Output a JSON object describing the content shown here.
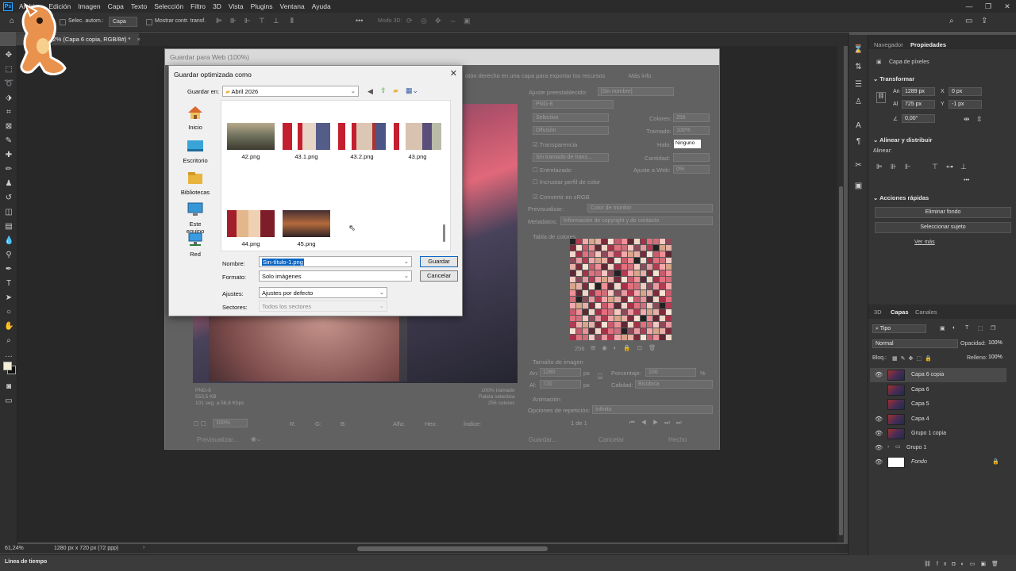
{
  "menu": {
    "app_icon": "Ps",
    "items": [
      "Archivo",
      "Edición",
      "Imagen",
      "Capa",
      "Texto",
      "Selección",
      "Filtro",
      "3D",
      "Vista",
      "Plugins",
      "Ventana",
      "Ayuda"
    ]
  },
  "options_bar": {
    "auto_select_label": "Selec. autom.:",
    "auto_select_value": "Capa",
    "show_transform_label": "Mostrar contr. transf.",
    "mode_3d": "Modo 3D:"
  },
  "document_tab": {
    "title": "61,2% (Capa 6 copia, RGB/8#) *",
    "close": "×"
  },
  "status_bar": {
    "zoom": "61,24%",
    "doc_size": "1280 px x 720 px (72 ppp)"
  },
  "timeline": {
    "label": "Línea de tiempo"
  },
  "save_for_web": {
    "title": "Guardar para Web (100%)",
    "hint": "otón derecho en una capa para exportar los recursos",
    "more_info": "Más info.",
    "preset_label": "Ajuste preestablecido:",
    "preset_value": "[Sin nombre]",
    "format": "PNG-8",
    "reduction": "Selectivo",
    "dither": "Difusión",
    "colors_label": "Colores:",
    "colors_value": "256",
    "dither_amount_label": "Tramado:",
    "dither_amount_value": "100%",
    "transparency": "Transparencia",
    "matte_label": "Halo:",
    "matte_value": "Ninguno",
    "transparency_dither": "Sin tramado de trans...",
    "amount_label": "Cantidad:",
    "interlaced": "Entrelazado",
    "web_snap_label": "Ajuste a Web:",
    "web_snap_value": "0%",
    "embed_profile": "Incrustar perfil de color",
    "convert_srgb": "Convertir en sRGB",
    "preview_label": "Previsualizar:",
    "preview_value": "Color de monitor",
    "metadata_label": "Metadatos:",
    "metadata_value": "Información de copyright y de contacto",
    "color_table": "Tabla de colores",
    "color_count": "256",
    "image_size": "Tamaño de imagen",
    "width_label": "An:",
    "width_value": "1280",
    "height_label": "Al:",
    "height_value": "720",
    "px": "px",
    "percent_label": "Porcentaje:",
    "percent_value": "100",
    "pct": "%",
    "quality_label": "Calidad:",
    "quality_value": "Bicúbica",
    "animation": "Animación",
    "loop_label": "Opciones de repetición:",
    "loop_value": "Infinito",
    "frame": "1 de 1",
    "info_left": [
      "PNG-8",
      "553,5 KB",
      "101 seg. a 56,6 Kbps"
    ],
    "info_right": [
      "100% tramado",
      "Paleta selectiva",
      "256 colores"
    ],
    "zoom": "100%",
    "readout": {
      "r": "R:",
      "g": "G:",
      "b": "B:",
      "alpha": "Alfa:",
      "hex": "Hex:",
      "index": "Índice:"
    },
    "preview_btn": "Previsualizar...",
    "save_btn": "Guardar...",
    "cancel_btn": "Cancelar",
    "done_btn": "Hecho",
    "palette": [
      "#e89aa0",
      "#c95b6d",
      "#f3c9c1",
      "#7b2b3c",
      "#e4707d",
      "#d8a58a",
      "#f0d8c8",
      "#b23b53",
      "#ef8f96",
      "#8c4b5a",
      "#f7e3d4",
      "#cf6f7b",
      "#e7b0a6",
      "#a5324a",
      "#f4a8ab",
      "#5c2a36"
    ]
  },
  "save_dialog": {
    "title": "Guardar optimizada como",
    "close": "✕",
    "save_in_label": "Guardar en:",
    "folder": "Abril 2026",
    "places": [
      "Inicio",
      "Escritorio",
      "Bibliotecas",
      "Este equipo",
      "Red"
    ],
    "files": [
      "42.png",
      "43.1.png",
      "43.2.png",
      "43.png",
      "44.png",
      "45.png"
    ],
    "name_label": "Nombre:",
    "name_value": "Sin-título-1.png",
    "format_label": "Formato:",
    "format_value": "Solo imágenes",
    "settings_label": "Ajustes:",
    "settings_value": "Ajustes por defecto",
    "slices_label": "Sectores:",
    "slices_value": "Todos los sectores",
    "save_btn": "Guardar",
    "cancel_btn": "Cancelar"
  },
  "right_panel": {
    "tabs": [
      "Navegador",
      "Propiedades"
    ],
    "layer_type": "Capa de píxeles",
    "transform_title": "Transformar",
    "w_label": "An",
    "w_value": "1289 px",
    "h_label": "Al",
    "h_value": "725 px",
    "x_label": "X",
    "x_value": "0 px",
    "y_label": "Y",
    "y_value": "-1 px",
    "angle_value": "0,00°",
    "align_title": "Alinear y distribuir",
    "align_label": "Alinear:",
    "quick_title": "Acciones rápidas",
    "remove_bg": "Eliminar fondo",
    "select_subject": "Seleccionar sujeto",
    "see_more": "Ver más",
    "more_dots": "•••"
  },
  "layers_panel": {
    "tabs": [
      "3D",
      "Capas",
      "Canales"
    ],
    "filter": "Tipo",
    "blend": "Normal",
    "opacity_label": "Opacidad:",
    "opacity_value": "100%",
    "lock_label": "Bloq.:",
    "fill_label": "Relleno:",
    "fill_value": "100%",
    "layers": [
      "Capa 6 copia",
      "Capa 6",
      "Capa 5",
      "Capa 4",
      "Grupo 1 copia",
      "Grupo 1",
      "Fondo"
    ]
  }
}
